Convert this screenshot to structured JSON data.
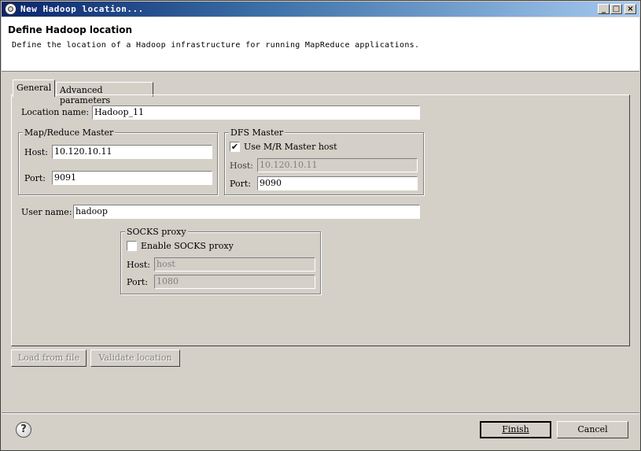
{
  "window": {
    "title": "New Hadoop location...",
    "controls": {
      "minimize": "_",
      "maximize": "□",
      "close": "×"
    }
  },
  "header": {
    "title": "Define Hadoop location",
    "description": "Define the location of a Hadoop infrastructure for running MapReduce applications."
  },
  "tabs": [
    {
      "label": "General",
      "active": true
    },
    {
      "label": "Advanced parameters",
      "active": false
    }
  ],
  "general": {
    "location_name_label": "Location name:",
    "location_name_value": "Hadoop_11",
    "mr_master": {
      "title": "Map/Reduce Master",
      "host_label": "Host:",
      "host_value": "10.120.10.11",
      "port_label": "Port:",
      "port_value": "9091"
    },
    "dfs_master": {
      "title": "DFS Master",
      "use_mr_label": "Use M/R Master host",
      "use_mr_checked": true,
      "host_label": "Host:",
      "host_value": "10.120.10.11",
      "port_label": "Port:",
      "port_value": "9090"
    },
    "user_name_label": "User name:",
    "user_name_value": "hadoop",
    "socks": {
      "title": "SOCKS proxy",
      "enable_label": "Enable SOCKS proxy",
      "enable_checked": false,
      "host_label": "Host:",
      "host_value": "host",
      "port_label": "Port:",
      "port_value": "1080"
    }
  },
  "actions": {
    "load_from_file": "Load from file",
    "validate_location": "Validate location"
  },
  "footer": {
    "help_icon": "?",
    "finish": "Finish",
    "cancel": "Cancel"
  },
  "colors": {
    "title_bar_start": "#0a246a",
    "title_bar_end": "#a6caf0",
    "dialog_face": "#d4d0c8"
  }
}
